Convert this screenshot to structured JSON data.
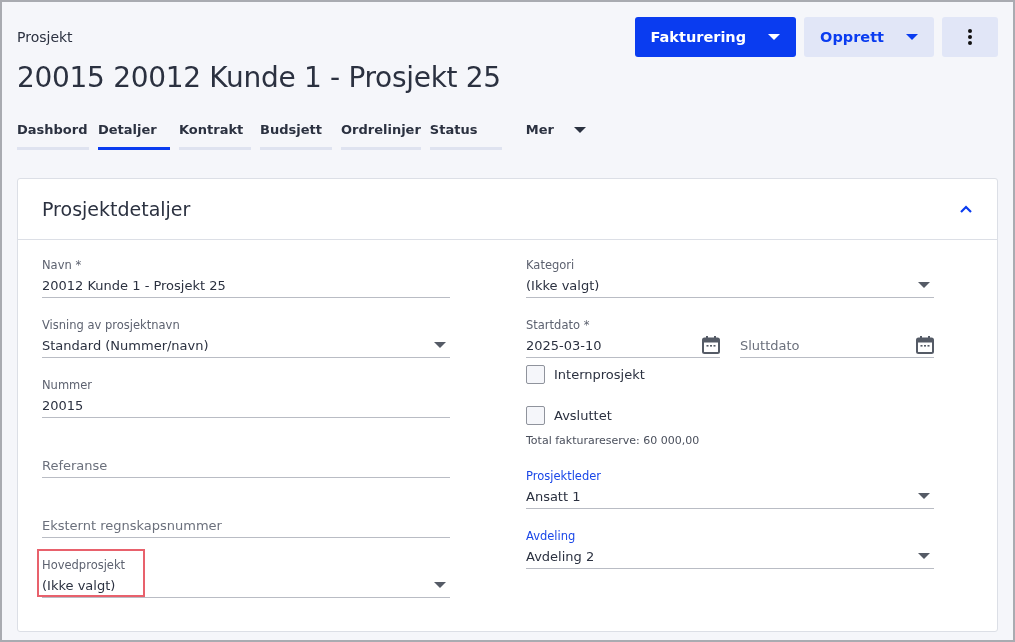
{
  "header": {
    "breadcrumb": "Prosjekt",
    "title": "20015 20012 Kunde 1 - Prosjekt 25"
  },
  "actions": [
    {
      "label": "Fakturering",
      "kind": "primary"
    },
    {
      "label": "Opprett",
      "kind": "secondary"
    },
    {
      "kind": "more"
    }
  ],
  "tabs": [
    {
      "label": "Dashbord",
      "selected": false
    },
    {
      "label": "Detaljer",
      "selected": true
    },
    {
      "label": "Kontrakt",
      "selected": false
    },
    {
      "label": "Budsjett",
      "selected": false
    },
    {
      "label": "Ordrelinjer",
      "selected": false
    },
    {
      "label": "Status",
      "selected": false
    }
  ],
  "more_tab": {
    "label": "Mer"
  },
  "card": {
    "title": "Prosjektdetaljer",
    "expanded": true,
    "left": [
      {
        "kind": "text",
        "label": "Navn *",
        "value": "20012 Kunde 1 - Prosjekt 25"
      },
      {
        "kind": "select",
        "label": "Visning av prosjektnavn",
        "value": "Standard (Nummer/navn)"
      },
      {
        "kind": "text",
        "label": "Nummer",
        "value": "20015"
      },
      {
        "kind": "text",
        "placeholder": "Referanse"
      },
      {
        "kind": "text",
        "placeholder": "Eksternt regnskapsnummer"
      },
      {
        "kind": "select",
        "label": "Hovedprosjekt",
        "value": "(Ikke valgt)",
        "outlined": true
      }
    ],
    "right": [
      {
        "kind": "select",
        "label": "Kategori",
        "value": "(Ikke valgt)"
      },
      {
        "kind": "dates",
        "fields": [
          {
            "label": "Startdato *",
            "value": "2025-03-10"
          },
          {
            "placeholder": "Sluttdato"
          }
        ]
      },
      {
        "kind": "checkbox",
        "label": "Internprosjekt",
        "checked": false
      },
      {
        "kind": "checkbox",
        "label": "Avsluttet",
        "checked": false
      },
      {
        "kind": "note",
        "text": "Total fakturareserve: 60 000,00"
      },
      {
        "kind": "select",
        "label": "Prosjektleder",
        "value": "Ansatt 1",
        "accent": true
      },
      {
        "kind": "select",
        "label": "Avdeling",
        "value": "Avdeling 2",
        "accent": true
      }
    ]
  }
}
